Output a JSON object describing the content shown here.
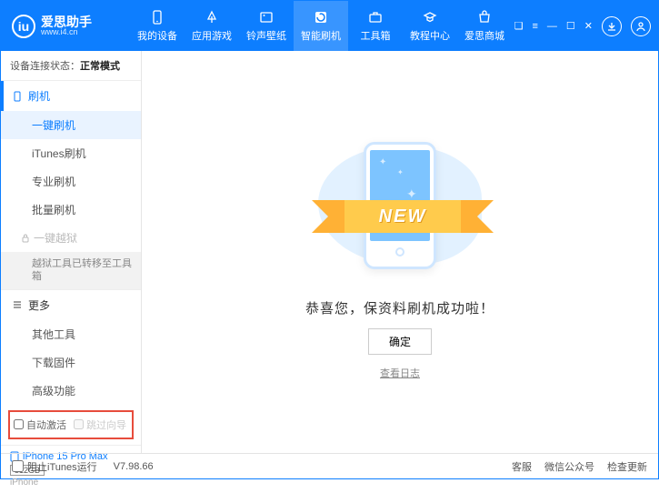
{
  "header": {
    "logo_title": "爱思助手",
    "logo_url": "www.i4.cn",
    "nav": [
      {
        "label": "我的设备"
      },
      {
        "label": "应用游戏"
      },
      {
        "label": "铃声壁纸"
      },
      {
        "label": "智能刷机"
      },
      {
        "label": "工具箱"
      },
      {
        "label": "教程中心"
      },
      {
        "label": "爱思商城"
      }
    ]
  },
  "sidebar": {
    "conn_label": "设备连接状态：",
    "conn_value": "正常模式",
    "flash_header": "刷机",
    "flash_items": [
      "一键刷机",
      "iTunes刷机",
      "专业刷机",
      "批量刷机"
    ],
    "jailbreak": "一键越狱",
    "jailbreak_info": "越狱工具已转移至工具箱",
    "more_header": "更多",
    "more_items": [
      "其他工具",
      "下载固件",
      "高级功能"
    ],
    "checkbox1": "自动激活",
    "checkbox2": "跳过向导",
    "device": {
      "name": "iPhone 15 Pro Max",
      "storage": "512GB",
      "type": "iPhone"
    }
  },
  "main": {
    "ribbon": "NEW",
    "message": "恭喜您，保资料刷机成功啦！",
    "ok": "确定",
    "log_link": "查看日志"
  },
  "statusbar": {
    "block_itunes": "阻止iTunes运行",
    "version": "V7.98.66",
    "right": [
      "客服",
      "微信公众号",
      "检查更新"
    ]
  }
}
